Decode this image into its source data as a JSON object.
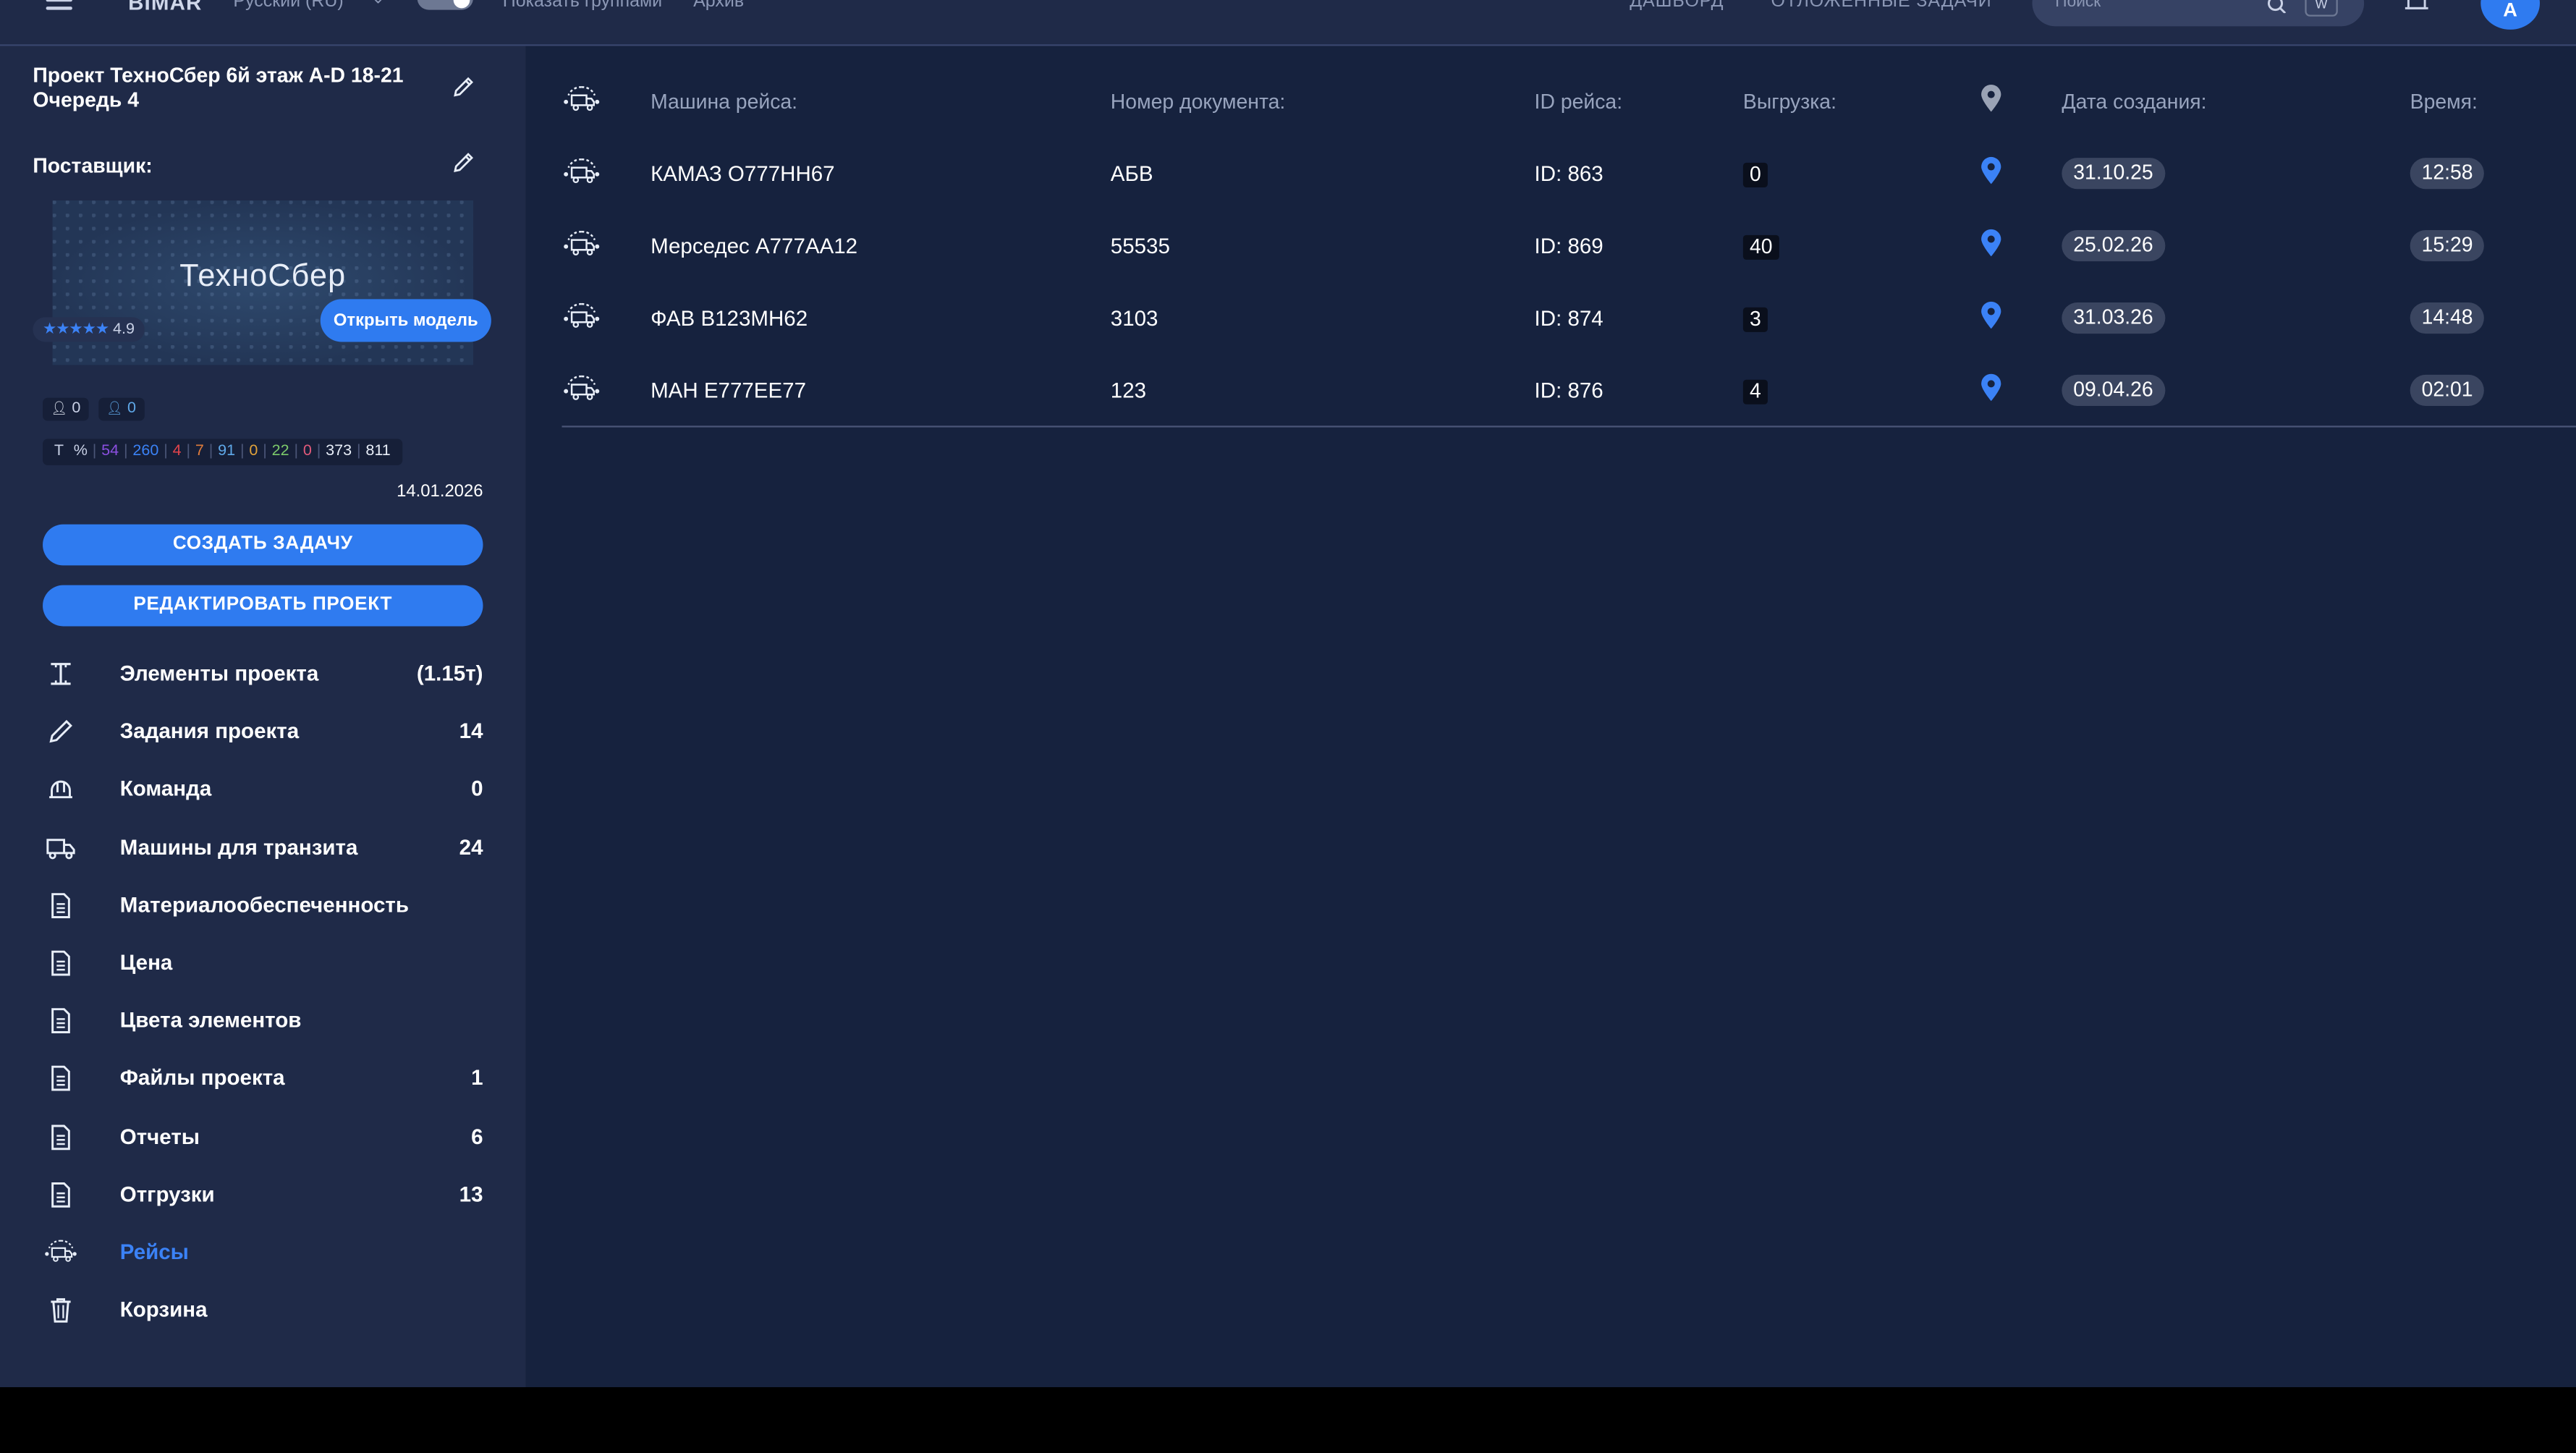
{
  "topbar": {
    "brand": "BIMAR",
    "language": "Русский (RU)",
    "group_toggle_label": "Показать группами",
    "archive_label": "Архив",
    "nav_dashboard": "ДАШБОРД",
    "nav_deferred": "ОТЛОЖЕННЫЕ ЗАДАЧИ",
    "search_placeholder": "Поиск",
    "search_shortcut": "W",
    "avatar_letter": "А"
  },
  "sidebar": {
    "project_title": "Проект ТехноСбер 6й этаж A-D 18-21 Очередь 4",
    "supplier_label": "Поставщик:",
    "model_logo": "ТехноСбер",
    "rating_stars": "★★★★★",
    "rating_value": "4.9",
    "open_model_label": "Открыть модель",
    "people": [
      "0",
      "0"
    ],
    "stats": [
      {
        "text": "T",
        "color": "#c9d1e6"
      },
      {
        "text": "%",
        "color": "#c9d1e6"
      },
      {
        "text": "54",
        "color": "#8b4fe0"
      },
      {
        "text": "260",
        "color": "#3b82f6"
      },
      {
        "text": "4",
        "color": "#e0434b"
      },
      {
        "text": "7",
        "color": "#e07c3b"
      },
      {
        "text": "91",
        "color": "#5fa8e8"
      },
      {
        "text": "0",
        "color": "#e0a23b"
      },
      {
        "text": "22",
        "color": "#7cc96b"
      },
      {
        "text": "0",
        "color": "#e05a7a"
      },
      {
        "text": "373",
        "color": "#e8eef8"
      },
      {
        "text": "811",
        "color": "#e8eef8"
      }
    ],
    "date": "14.01.2026",
    "create_task_label": "СОЗДАТЬ ЗАДАЧУ",
    "edit_project_label": "РЕДАКТИРОВАТЬ ПРОЕКТ",
    "nav": [
      {
        "label": "Элементы проекта",
        "count": "(1.15т)",
        "icon": "i-beam-icon"
      },
      {
        "label": "Задания проекта",
        "count": "14",
        "icon": "pencil-icon"
      },
      {
        "label": "Команда",
        "count": "0",
        "icon": "hard-hat-icon"
      },
      {
        "label": "Машины для транзита",
        "count": "24",
        "icon": "truck-icon"
      },
      {
        "label": "Материалообеспеченность",
        "count": "",
        "icon": "document-icon"
      },
      {
        "label": "Цена",
        "count": "",
        "icon": "document-icon"
      },
      {
        "label": "Цвета элементов",
        "count": "",
        "icon": "document-icon"
      },
      {
        "label": "Файлы проекта",
        "count": "1",
        "icon": "document-icon"
      },
      {
        "label": "Отчеты",
        "count": "6",
        "icon": "document-icon"
      },
      {
        "label": "Отгрузки",
        "count": "13",
        "icon": "document-icon"
      },
      {
        "label": "Рейсы",
        "count": "",
        "icon": "truck-route-icon"
      },
      {
        "label": "Корзина",
        "count": "",
        "icon": "trash-icon"
      }
    ]
  },
  "table": {
    "headers": {
      "vehicle": "Машина рейса:",
      "document": "Номер документа:",
      "trip_id": "ID рейса:",
      "unload": "Выгрузка:",
      "created": "Дата создания:",
      "time": "Время:"
    },
    "rows": [
      {
        "vehicle": "КАМАЗ О777НН67",
        "document": "АБВ",
        "trip_id": "ID: 863",
        "unload": "0",
        "created": "31.10.25",
        "time": "12:58"
      },
      {
        "vehicle": "Мерседес А777АА12",
        "document": "55535",
        "trip_id": "ID: 869",
        "unload": "40",
        "created": "25.02.26",
        "time": "15:29"
      },
      {
        "vehicle": "ФАВ В123МН62",
        "document": "3103",
        "trip_id": "ID: 874",
        "unload": "3",
        "created": "31.03.26",
        "time": "14:48"
      },
      {
        "vehicle": "МАН Е777ЕЕ77",
        "document": "123",
        "trip_id": "ID: 876",
        "unload": "4",
        "created": "09.04.26",
        "time": "02:01"
      }
    ]
  },
  "colors": {
    "accent": "#2f7bf0",
    "sidebar_bg": "#1f2a48",
    "main_bg": "#16223e"
  }
}
